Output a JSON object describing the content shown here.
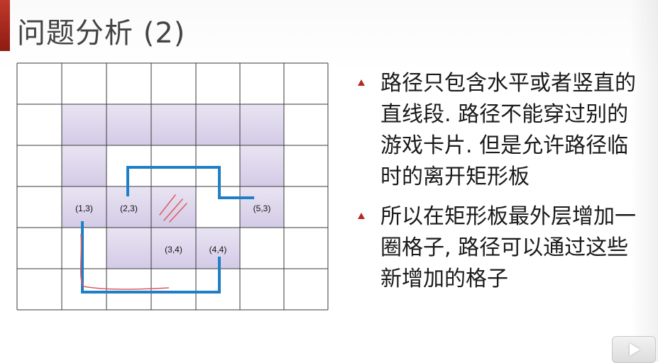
{
  "slide": {
    "title": "问题分析 (2)"
  },
  "grid": {
    "rows": 6,
    "cols": 7,
    "shaded_cells": [
      [
        1,
        1
      ],
      [
        2,
        1
      ],
      [
        3,
        1
      ],
      [
        4,
        1
      ],
      [
        5,
        1
      ],
      [
        1,
        2
      ],
      [
        5,
        2
      ],
      [
        1,
        3
      ],
      [
        2,
        3
      ],
      [
        3,
        3
      ],
      [
        5,
        3
      ],
      [
        2,
        4
      ],
      [
        3,
        4
      ],
      [
        4,
        4
      ]
    ],
    "hatched_cell": [
      3,
      3
    ],
    "labels": [
      {
        "col": 1,
        "row": 3,
        "text": "(1,3)"
      },
      {
        "col": 2,
        "row": 3,
        "text": "(2,3)"
      },
      {
        "col": 5,
        "row": 3,
        "text": "(5,3)"
      },
      {
        "col": 3,
        "row": 4,
        "text": "(3,4)"
      },
      {
        "col": 4,
        "row": 4,
        "text": "(4,4)"
      }
    ],
    "colors": {
      "line": "#3a3a3a",
      "shade": "#ddd6ec",
      "path": "#1f7fc6",
      "annotation": "#e05a5a"
    }
  },
  "bullets": [
    {
      "text": "路径只包含水平或者竖直的直线段. 路径不能穿过别的游戏卡片. 但是允许路径临时的离开矩形板"
    },
    {
      "text": "所以在矩形板最外层增加一圈格子, 路径可以通过这些新增加的格子"
    }
  ],
  "player": {
    "icon": "play-icon"
  }
}
